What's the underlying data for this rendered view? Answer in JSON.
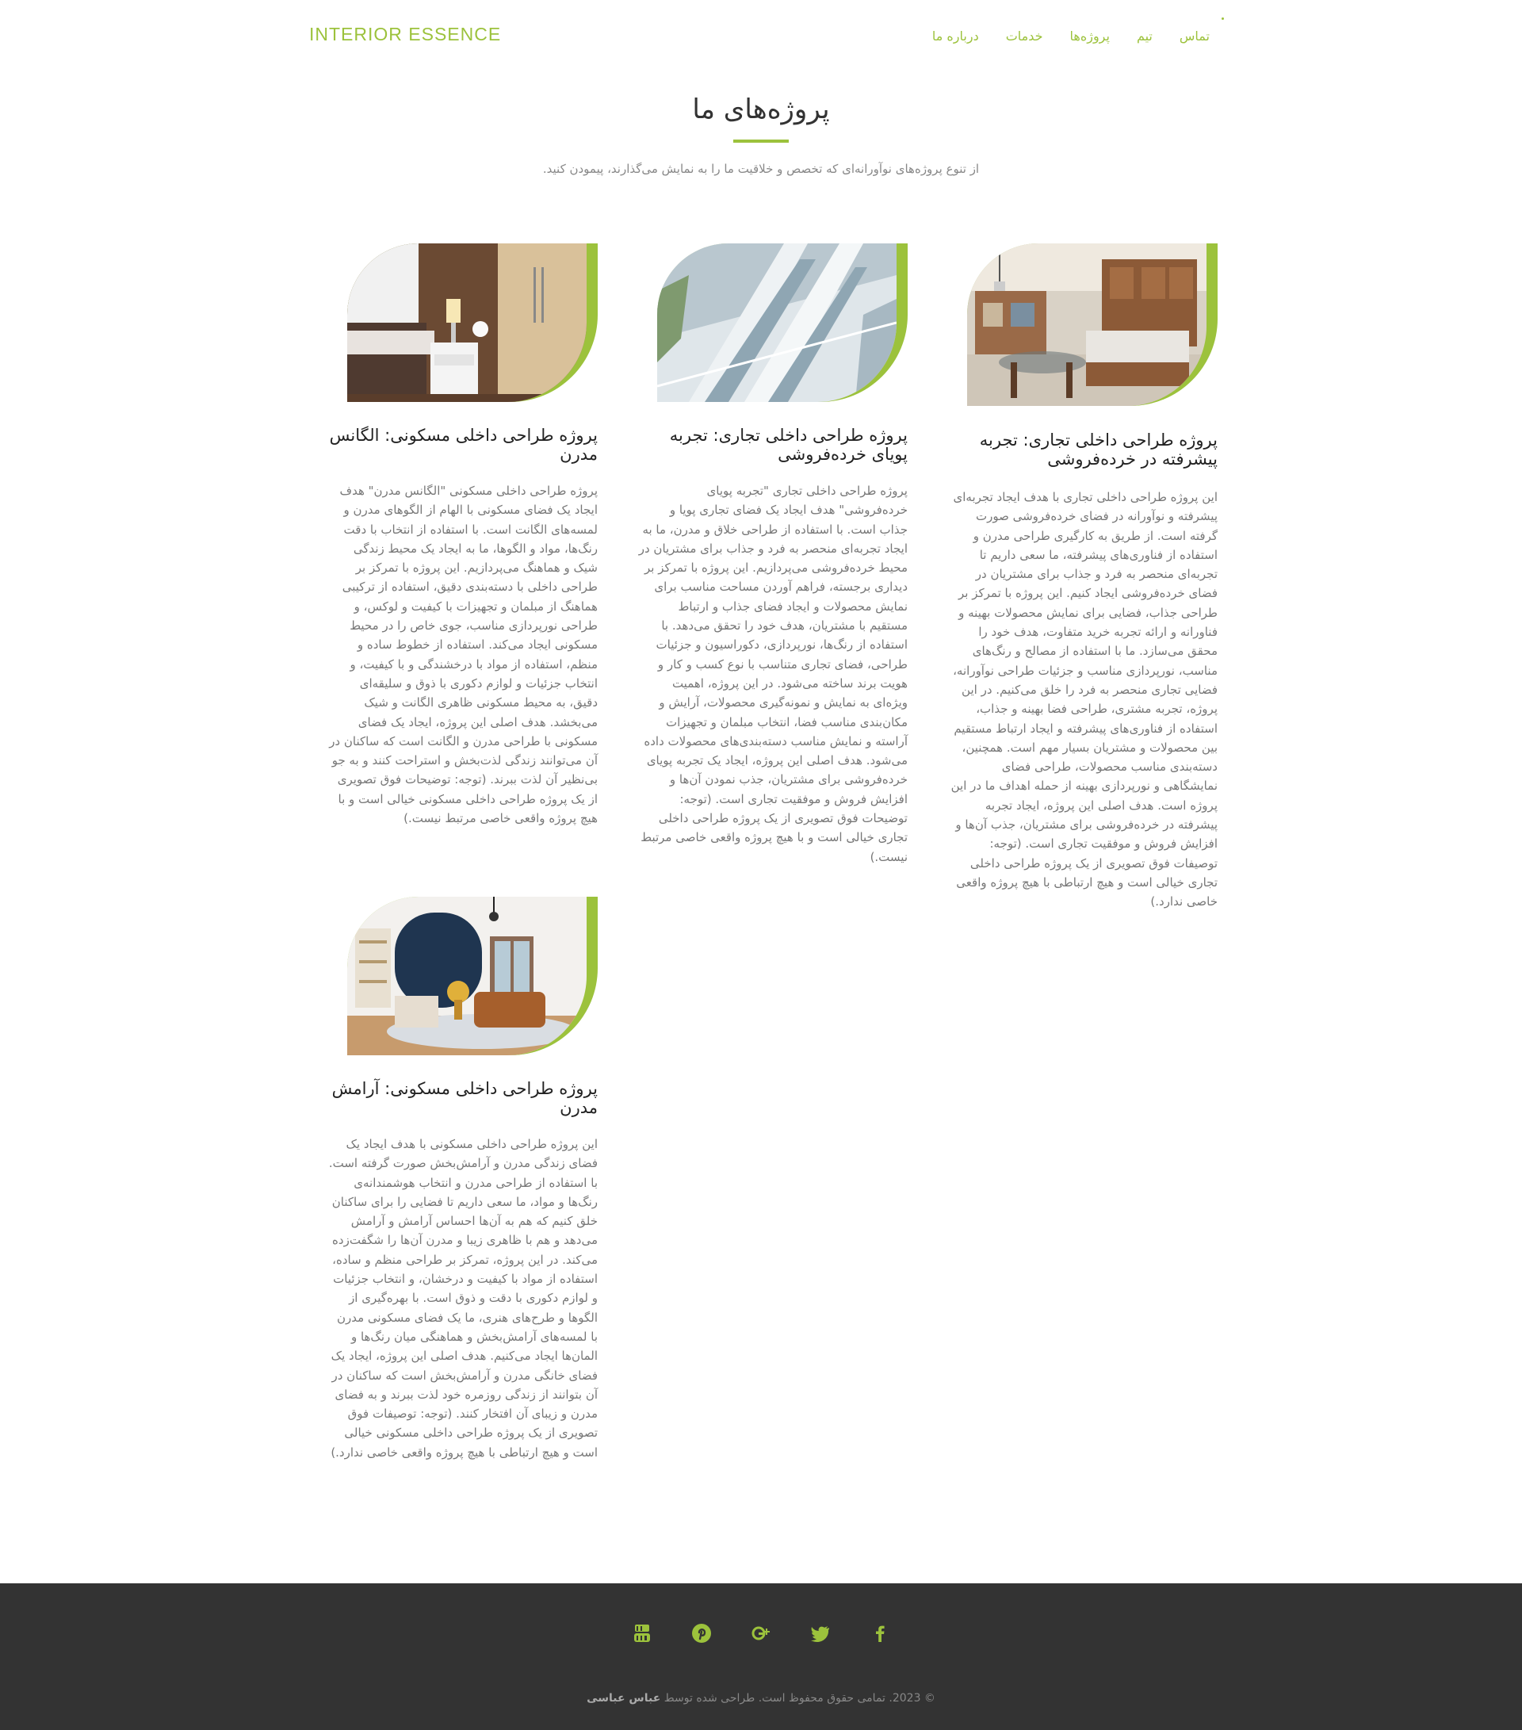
{
  "header": {
    "logo": "INTERIOR ESSENCE",
    "nav": [
      "تماس",
      "تیم",
      "پروژه‌ها",
      "خدمات",
      "درباره ما"
    ]
  },
  "section": {
    "title": "پروژه‌های ما",
    "subtitle": "از تنوع پروژه‌های نوآورانه‌ای که تخصص و خلاقیت ما را به نمایش می‌گذارند، پیمودن کنید."
  },
  "projects": [
    {
      "title": "پروژه طراحی داخلی تجاری: تجربه پیشرفته در خرده‌فروشی",
      "text": "این پروژه طراحی داخلی تجاری با هدف ایجاد تجربه‌ای پیشرفته و نوآورانه در فضای خرده‌فروشی صورت گرفته است. از طریق به کارگیری طراحی مدرن و استفاده از فناوری‌های پیشرفته، ما سعی داریم تا تجربه‌ای منحصر به فرد و جذاب برای مشتریان در فضای خرده‌فروشی ایجاد کنیم. این پروژه با تمرکز بر طراحی جذاب، فضایی برای نمایش محصولات بهینه و فناورانه و ارائه تجربه خرید متفاوت، هدف خود را محقق می‌سازد. ما با استفاده از مصالح و رنگ‌های مناسب، نورپردازی مناسب و جزئیات طراحی نوآورانه، فضایی تجاری منحصر به فرد را خلق می‌کنیم. در این پروژه، تجربه مشتری، طراحی فضا بهینه و جذاب، استفاده از فناوری‌های پیشرفته و ایجاد ارتباط مستقیم بین محصولات و مشتریان بسیار مهم است. همچنین، دسته‌بندی مناسب محصولات، طراحی فضای نمایشگاهی و نورپردازی بهینه از حمله اهداف ما در این پروژه است. هدف اصلی این پروژه، ایجاد تجربه پیشرفته در خرده‌فروشی برای مشتریان، جذب آن‌ها و افزایش فروش و موفقیت تجاری است. (توجه: توصیفات فوق تصویری از یک پروژه طراحی داخلی تجاری خیالی است و هیچ ارتباطی با هیچ پروژه واقعی خاصی ندارد.)"
    },
    {
      "title": "پروژه طراحی داخلی تجاری: تجربه پویای خرده‌فروشی",
      "text": "پروژه طراحی داخلی تجاری \"تجربه پویای خرده‌فروشی\" هدف ایجاد یک فضای تجاری پویا و جذاب است. با استفاده از طراحی خلاق و مدرن، ما به ایجاد تجربه‌ای منحصر به فرد و جذاب برای مشتریان در محیط خرده‌فروشی می‌پردازیم. این پروژه با تمرکز بر دیداری برجسته، فراهم آوردن مساحت مناسب برای نمایش محصولات و ایجاد فضای جذاب و ارتباط مستقیم با مشتریان، هدف خود را تحقق می‌دهد. با استفاده از رنگ‌ها، نورپردازی، دکوراسیون و جزئیات طراحی، فضای تجاری متناسب با نوع کسب و کار و هویت برند ساخته می‌شود. در این پروژه، اهمیت ویژه‌ای به نمایش و نمونه‌گیری محصولات، آرایش و مکان‌بندی مناسب فضا، انتخاب مبلمان و تجهیزات آراسته و نمایش مناسب دسته‌بندی‌های محصولات داده می‌شود. هدف اصلی این پروژه، ایجاد یک تجربه پویای خرده‌فروشی برای مشتریان، جذب نمودن آن‌ها و افزایش فروش و موفقیت تجاری است. (توجه: توضیحات فوق تصویری از یک پروژه طراحی داخلی تجاری خیالی است و با هیچ پروژه واقعی خاصی مرتبط نیست.)"
    },
    {
      "title": "پروژه طراحی داخلی مسکونی: الگانس مدرن",
      "text": "پروژه طراحی داخلی مسکونی \"الگانس مدرن\" هدف ایجاد یک فضای مسکونی با الهام از الگوهای مدرن و لمسه‌های الگانت است. با استفاده از انتخاب با دقت رنگ‌ها، مواد و الگوها، ما به ایجاد یک محیط زندگی شیک و هماهنگ می‌پردازیم. این پروژه با تمرکز بر طراحی داخلی با دسته‌بندی دقیق، استفاده از ترکیبی هماهنگ از مبلمان و تجهیزات با کیفیت و لوکس، و طراحی نورپردازی مناسب، جوی خاص را در محیط مسکونی ایجاد می‌کند. استفاده از خطوط ساده و منظم، استفاده از مواد با درخشندگی و با کیفیت، و انتخاب جزئیات و لوازم دکوری با ذوق و سلیقه‌ای دقیق، به محیط مسکونی ظاهری الگانت و شیک می‌بخشد. هدف اصلی این پروژه، ایجاد یک فضای مسکونی با طراحی مدرن و الگانت است که ساکنان در آن می‌توانند زندگی لذت‌بخش و استراحت کنند و به جو بی‌نظیر آن لذت ببرند. (توجه: توضیحات فوق تصویری از یک پروژه طراحی داخلی مسکونی خیالی است و با هیچ پروژه واقعی خاصی مرتبط نیست.)"
    },
    {
      "title": "پروژه طراحی داخلی مسکونی: آرامش مدرن",
      "text": "این پروژه طراحی داخلی مسکونی با هدف ایجاد یک فضای زندگی مدرن و آرامش‌بخش صورت گرفته است. با استفاده از طراحی مدرن و انتخاب هوشمندانه‌ی رنگ‌ها و مواد، ما سعی داریم تا فضایی را برای ساکنان خلق کنیم که هم به آن‌ها احساس آرامش و آرامش می‌دهد و هم با ظاهری زیبا و مدرن آن‌ها را شگفت‌زده می‌کند. در این پروژه، تمرکز بر طراحی منظم و ساده، استفاده از مواد با کیفیت و درخشان، و انتخاب جزئیات و لوازم دکوری با دقت و ذوق است. با بهره‌گیری از الگوها و طرح‌های هنری، ما یک فضای مسکونی مدرن با لمسه‌های آرامش‌بخش و هماهنگی میان رنگ‌ها و المان‌ها ایجاد می‌کنیم. هدف اصلی این پروژه، ایجاد یک فضای خانگی مدرن و آرامش‌بخش است که ساکنان در آن بتوانند از زندگی روزمره خود لذت ببرند و به فضای مدرن و زیبای آن افتخار کنند. (توجه: توصیفات فوق تصویری از یک پروژه طراحی داخلی مسکونی خیالی است و هیچ ارتباطی با هیچ پروژه واقعی خاصی ندارد.)"
    }
  ],
  "footer": {
    "social": [
      "facebook-icon",
      "twitter-icon",
      "google-plus-icon",
      "pinterest-icon",
      "youtube-icon"
    ],
    "copyright": "© 2023. تمامی حقوق محفوظ است. طراحی شده توسط",
    "author": "عباس عباسی"
  },
  "colors": {
    "accent": "#9cc23c",
    "footer_bg": "#333333"
  }
}
